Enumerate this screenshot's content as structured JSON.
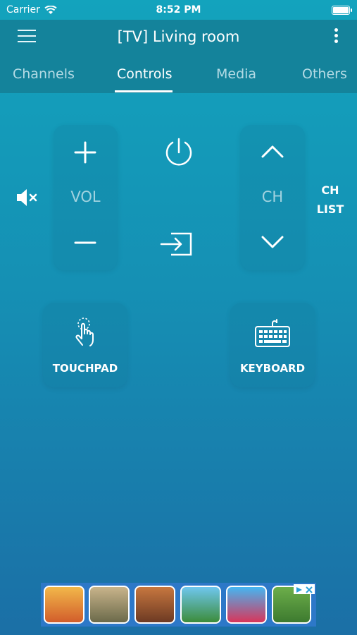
{
  "status_bar": {
    "carrier": "Carrier",
    "time": "8:52 PM"
  },
  "header": {
    "title": "[TV] Living room"
  },
  "tabs": [
    {
      "label": "Channels"
    },
    {
      "label": "Controls"
    },
    {
      "label": "Media"
    },
    {
      "label": "Others"
    }
  ],
  "controls": {
    "vol_label": "VOL",
    "ch_label": "CH",
    "ch_list_line1": "CH",
    "ch_list_line2": "LIST",
    "touchpad_label": "TOUCHPAD",
    "keyboard_label": "KEYBOARD"
  },
  "icons": {
    "menu": "hamburger-icon",
    "more": "vertical-dots-icon",
    "mute": "speaker-mute-icon",
    "power": "power-icon",
    "input": "input-source-icon",
    "touchpad": "finger-tap-icon",
    "keyboard": "keyboard-icon"
  },
  "colors": {
    "accent": "#14839b",
    "background_top": "#13a3bd",
    "background_bottom": "#1b6fa6"
  }
}
